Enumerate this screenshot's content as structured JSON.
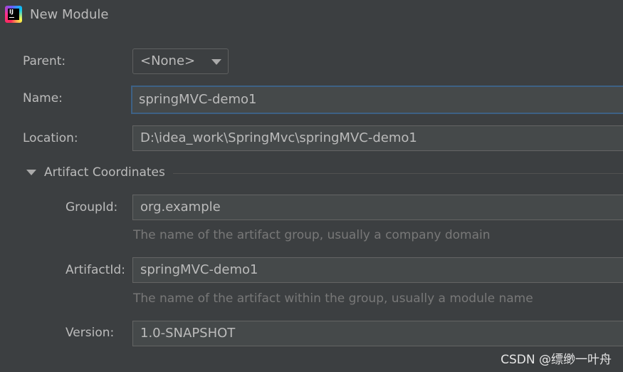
{
  "window": {
    "title": "New Module",
    "icon": "intellij-idea-icon",
    "icon_text": "IJ"
  },
  "form": {
    "parent": {
      "label": "Parent:",
      "value": "<None>"
    },
    "name": {
      "label": "Name:",
      "value": "springMVC-demo1"
    },
    "location": {
      "label": "Location:",
      "value": "D:\\idea_work\\SpringMvc\\springMVC-demo1"
    }
  },
  "artifact": {
    "section_title": "Artifact Coordinates",
    "expanded": true,
    "group_id": {
      "label": "GroupId:",
      "value": "org.example",
      "hint": "The name of the artifact group, usually a company domain"
    },
    "artifact_id": {
      "label": "ArtifactId:",
      "value": "springMVC-demo1",
      "hint": "The name of the artifact within the group, usually a module name"
    },
    "version": {
      "label": "Version:",
      "value": "1.0-SNAPSHOT"
    }
  },
  "watermark": "CSDN @缥缈一叶舟",
  "colors": {
    "background": "#3c3f41",
    "field_background": "#45494a",
    "focus_border": "#3d6185",
    "hint_text": "#787878",
    "text": "#bbbbbb"
  }
}
